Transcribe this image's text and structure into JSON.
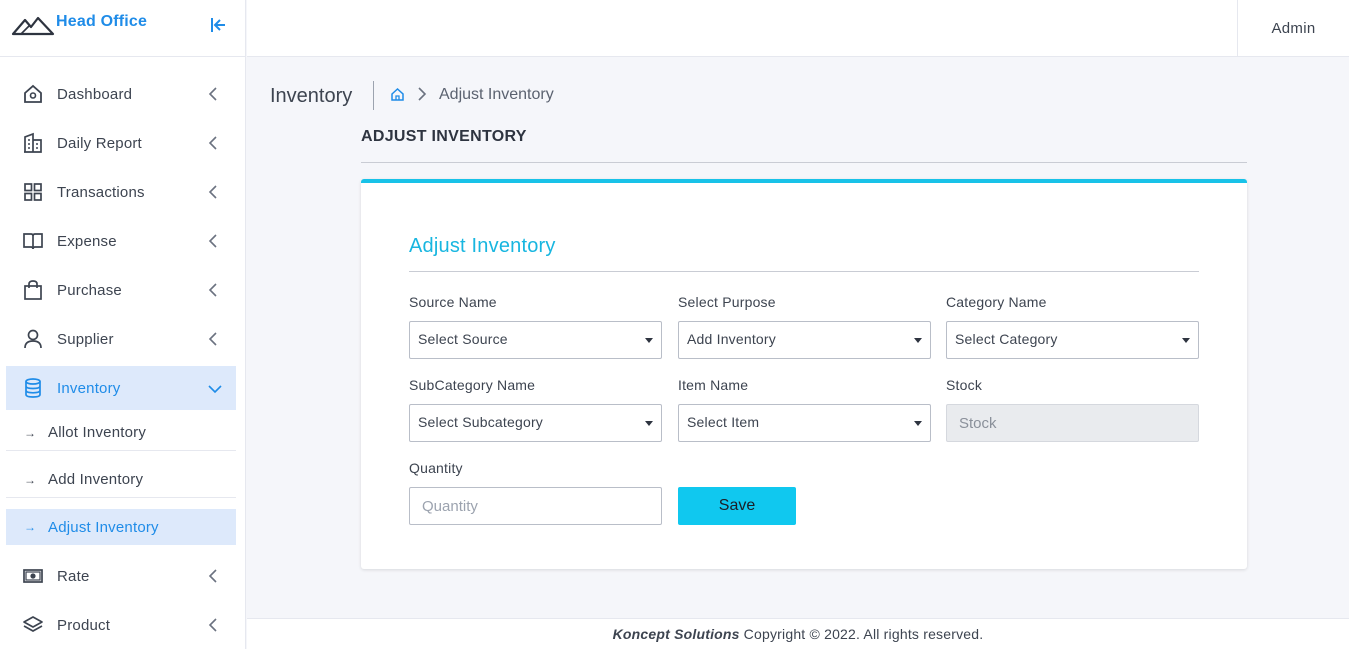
{
  "brand": {
    "name": "Head Office"
  },
  "header": {
    "user": "Admin"
  },
  "sidebar": {
    "items": [
      {
        "label": "Dashboard"
      },
      {
        "label": "Daily Report"
      },
      {
        "label": "Transactions"
      },
      {
        "label": "Expense"
      },
      {
        "label": "Purchase"
      },
      {
        "label": "Supplier"
      },
      {
        "label": "Inventory"
      },
      {
        "label": "Rate"
      },
      {
        "label": "Product"
      }
    ],
    "inventory_sub": [
      {
        "label": "Allot Inventory"
      },
      {
        "label": "Add Inventory"
      },
      {
        "label": "Adjust Inventory"
      }
    ]
  },
  "breadcrumb": {
    "title": "Inventory",
    "current": "Adjust Inventory"
  },
  "section": {
    "heading": "ADJUST INVENTORY"
  },
  "form": {
    "title": "Adjust Inventory",
    "source": {
      "label": "Source Name",
      "value": "Select Source"
    },
    "purpose": {
      "label": "Select Purpose",
      "value": "Add Inventory"
    },
    "category": {
      "label": "Category Name",
      "value": "Select Category"
    },
    "subcategory": {
      "label": "SubCategory Name",
      "value": "Select Subcategory"
    },
    "item": {
      "label": "Item Name",
      "value": "Select Item"
    },
    "stock": {
      "label": "Stock",
      "placeholder": "Stock"
    },
    "quantity": {
      "label": "Quantity",
      "placeholder": "Quantity"
    },
    "save_label": "Save"
  },
  "footer": {
    "company": "Koncept Solutions",
    "text": "Copyright © 2022. All rights reserved."
  },
  "colors": {
    "accent": "#1f8ce8",
    "card_accent": "#18c2e8",
    "button": "#10c8ef"
  }
}
